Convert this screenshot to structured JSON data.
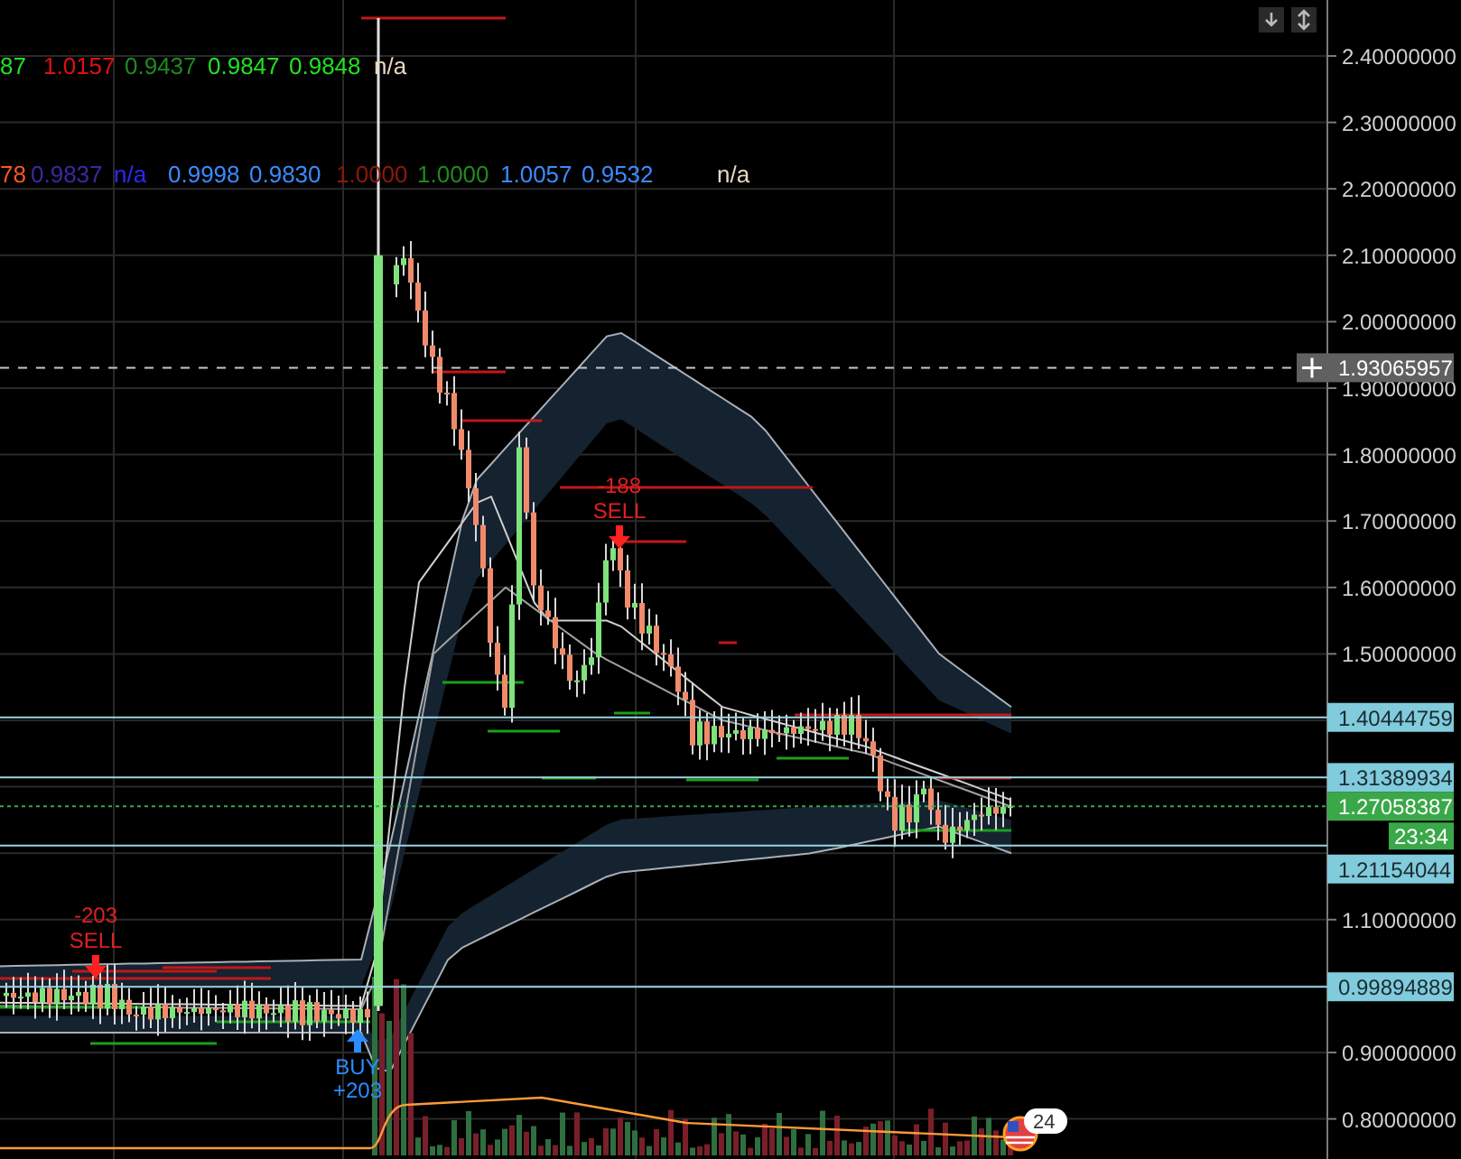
{
  "legend_rows": [
    {
      "values": [
        {
          "text": "87",
          "color": "#22e022"
        },
        {
          "text": "1.0157",
          "color": "#e01010"
        },
        {
          "text": "0.9437",
          "color": "#1e8a1e"
        },
        {
          "text": "0.9847",
          "color": "#22e022"
        },
        {
          "text": "0.9848",
          "color": "#22e022"
        },
        {
          "text": "n/a",
          "color": "#e8d8c0"
        }
      ]
    },
    {
      "values": [
        {
          "text": "78",
          "color": "#ff5a1a"
        },
        {
          "text": "0.9837",
          "color": "#3a2aa0"
        },
        {
          "text": "n/a",
          "color": "#2a2aff"
        },
        {
          "text": "0.9998",
          "color": "#3a8cff"
        },
        {
          "text": "0.9830",
          "color": "#3a8cff"
        },
        {
          "text": "1.0000",
          "color": "#8a1a0a"
        },
        {
          "text": "1.0000",
          "color": "#1e8a1e"
        },
        {
          "text": "1.0057",
          "color": "#3a8cff"
        },
        {
          "text": "0.9532",
          "color": "#3a8cff"
        },
        {
          "text": "n/a",
          "color": "#e8d8c0"
        }
      ]
    }
  ],
  "price_axis": {
    "ticks": [
      "2.40000000",
      "2.30000000",
      "2.20000000",
      "2.10000000",
      "2.00000000",
      "1.90000000",
      "1.80000000",
      "1.70000000",
      "1.60000000",
      "1.50000000",
      "1.10000000",
      "0.90000000",
      "0.80000000"
    ]
  },
  "price_levels": [
    {
      "kind": "crosshair",
      "text": "1.93065957"
    },
    {
      "kind": "level",
      "text": "1.40444759"
    },
    {
      "kind": "level",
      "text": "1.31389934"
    },
    {
      "kind": "current",
      "text": "1.27058387"
    },
    {
      "kind": "level",
      "text": "1.21154044"
    },
    {
      "kind": "level",
      "text": "0.99894889"
    }
  ],
  "countdown": "23:34",
  "trades": [
    {
      "kind": "sell",
      "amount": "-203",
      "label": "SELL"
    },
    {
      "kind": "buy",
      "label": "BUY",
      "amount": "+203"
    },
    {
      "kind": "sell",
      "amount": "-188",
      "label": "SELL"
    }
  ],
  "event_badge": "24"
}
